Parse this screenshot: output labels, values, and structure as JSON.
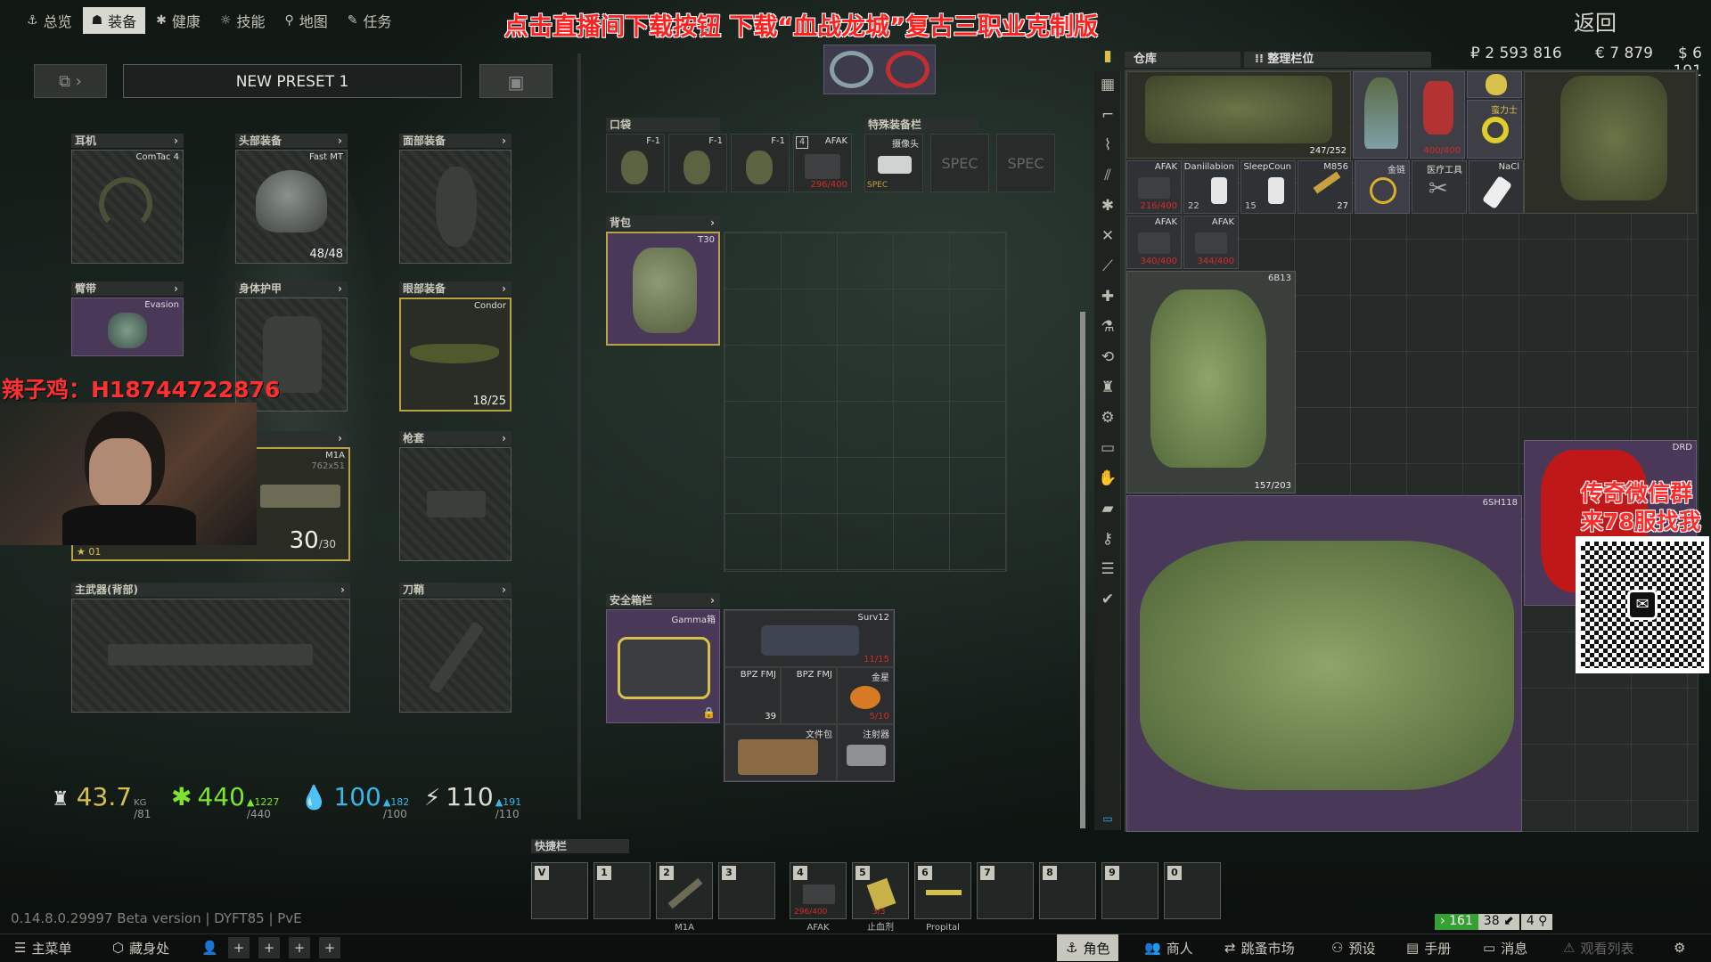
{
  "nav": {
    "tabs": [
      {
        "label": "总览",
        "icon": "anchor-icon"
      },
      {
        "label": "装备",
        "icon": "gear-icon"
      },
      {
        "label": "健康",
        "icon": "health-icon"
      },
      {
        "label": "技能",
        "icon": "skills-icon"
      },
      {
        "label": "地图",
        "icon": "map-pin-icon"
      },
      {
        "label": "任务",
        "icon": "tasks-icon"
      }
    ],
    "promo": "点击直播间下载按钮  下载“血战龙城”复古三职业克制版",
    "back": "返回"
  },
  "currency": {
    "rub": "₽ 2 593 816",
    "eur": "€ 7 879",
    "usd": "$ 6 191"
  },
  "preset": {
    "name": "NEW PRESET 1"
  },
  "slots": {
    "earpiece": {
      "header": "耳机",
      "item": "ComTac 4"
    },
    "headwear": {
      "header": "头部装备",
      "item": "Fast MT",
      "durability": "48/48"
    },
    "facecover": {
      "header": "面部装备"
    },
    "armband": {
      "header": "臂带",
      "item": "Evasion"
    },
    "body_armor": {
      "header": "身体护甲"
    },
    "eyewear": {
      "header": "眼部装备",
      "item": "Condor",
      "durability": "18/25"
    },
    "primary": {
      "item": "M1A",
      "caliber": "762x51",
      "ammo": "30",
      "ammo_max": "/30",
      "rank": "01"
    },
    "holster": {
      "header": "枪套"
    },
    "primary_back": {
      "header": "主武器(背部)"
    },
    "scabbard": {
      "header": "刀鞘"
    }
  },
  "streamer": {
    "overlay": "辣子鸡：H18744722876"
  },
  "pockets": {
    "header": "口袋",
    "items": [
      {
        "label": "F-1"
      },
      {
        "label": "F-1"
      },
      {
        "label": "F-1"
      },
      {
        "label": "AFAK",
        "count": "4",
        "hp": "296/400"
      }
    ]
  },
  "special": {
    "header": "特殊装备栏",
    "items": [
      {
        "label": "摄像头",
        "tag": "SPEC"
      },
      {
        "label": "SPEC"
      },
      {
        "label": "SPEC"
      }
    ]
  },
  "backpack": {
    "header": "背包",
    "item": "T30"
  },
  "secure": {
    "header": "安全箱栏",
    "item": "Gamma箱",
    "contents": [
      {
        "label": "Surv12",
        "hp": "11/15"
      },
      {
        "label": "BPZ FMJ",
        "count": "39"
      },
      {
        "label": "BPZ FMJ"
      },
      {
        "label": "金星",
        "hp": "5/10"
      },
      {
        "label": "文件包"
      },
      {
        "label": "注射器"
      }
    ]
  },
  "stats": {
    "weight": "43.7",
    "weight_unit": "KG",
    "weight_max": "/81",
    "health": "440",
    "health_max": "/440",
    "health_delta": "▲1227",
    "hydration": "100",
    "hydration_max": "/100",
    "hydration_delta": "▲182",
    "energy": "110",
    "energy_max": "/110",
    "energy_delta": "▲191"
  },
  "stash": {
    "tab_storage": "仓库",
    "tab_sort": "整理栏位",
    "items": [
      {
        "label": "",
        "count": "247/252"
      },
      {
        "label": "",
        "count": ""
      },
      {
        "label": "",
        "hp": "400/400"
      },
      {
        "label": "",
        "count": ""
      },
      {
        "label": "蛮力士",
        "count": ""
      },
      {
        "label": "AFAK",
        "hp": "216/400"
      },
      {
        "label": "Daniilabion",
        "count": "22"
      },
      {
        "label": "SleepCoun",
        "count": "15"
      },
      {
        "label": "M856",
        "count": "27"
      },
      {
        "label": "金链"
      },
      {
        "label": "医疗工具"
      },
      {
        "label": "NaCl"
      },
      {
        "label": "AFAK",
        "hp": "340/400"
      },
      {
        "label": "AFAK",
        "hp": "344/400"
      }
    ],
    "armor": {
      "label": "6B13",
      "count": "157/203"
    },
    "vest": {
      "label": "DRD"
    },
    "pack": {
      "label": "6SH118"
    }
  },
  "ad": {
    "line1": "传奇微信群",
    "line2": "来78服找我"
  },
  "quickbar": {
    "header": "快捷栏",
    "slots": [
      {
        "key": "V",
        "name": ""
      },
      {
        "key": "1",
        "name": ""
      },
      {
        "key": "2",
        "name": "M1A"
      },
      {
        "key": "3",
        "name": ""
      },
      {
        "key": "4",
        "name": "AFAK",
        "hp": "296/400"
      },
      {
        "key": "5",
        "name": "止血剂",
        "hp": "3/3"
      },
      {
        "key": "6",
        "name": "Propital"
      },
      {
        "key": "7",
        "name": ""
      },
      {
        "key": "8",
        "name": ""
      },
      {
        "key": "9",
        "name": ""
      },
      {
        "key": "0",
        "name": ""
      }
    ]
  },
  "version": "0.14.8.0.29997 Beta version | DYFT85 | PvE",
  "counters": {
    "a": "161",
    "b": "38",
    "c": "4"
  },
  "bottom": {
    "left": [
      {
        "label": "主菜单"
      },
      {
        "label": "藏身处"
      }
    ],
    "right": [
      {
        "label": "角色"
      },
      {
        "label": "商人"
      },
      {
        "label": "跳蚤市场"
      },
      {
        "label": "预设"
      },
      {
        "label": "手册"
      },
      {
        "label": "消息"
      },
      {
        "label": "观看列表"
      }
    ]
  },
  "colors": {
    "accent_yellow": "#d8c14a",
    "purple": "#4a3858",
    "red": "#d42b2b",
    "ad_red": "#ff2a2a",
    "green": "#36a032"
  }
}
